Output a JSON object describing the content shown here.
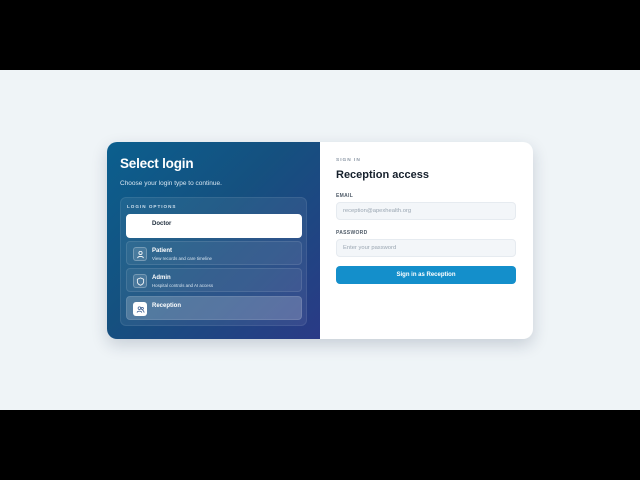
{
  "left": {
    "title": "Select login",
    "subtitle": "Choose your login type to continue.",
    "options_heading": "LOGIN OPTIONS",
    "options": [
      {
        "label": "Doctor",
        "desc": "",
        "icon": "stethoscope-icon",
        "selected": true
      },
      {
        "label": "Patient",
        "desc": "View records and care timeline",
        "icon": "user-icon"
      },
      {
        "label": "Admin",
        "desc": "Hospital controls and AI access",
        "icon": "shield-icon"
      },
      {
        "label": "Reception",
        "desc": "",
        "icon": "users-icon",
        "hovered": true
      }
    ]
  },
  "right": {
    "eyebrow": "SIGN IN",
    "title": "Reception access",
    "email_label": "EMAIL",
    "email_placeholder": "reception@apexhealth.org",
    "password_label": "PASSWORD",
    "password_placeholder": "Enter your password",
    "submit_label": "Sign in as Reception"
  },
  "colors": {
    "accent": "#148fcb",
    "panel_gradient_start": "#0b5f8e",
    "panel_gradient_end": "#2a3a86",
    "background": "#eff4f7"
  }
}
